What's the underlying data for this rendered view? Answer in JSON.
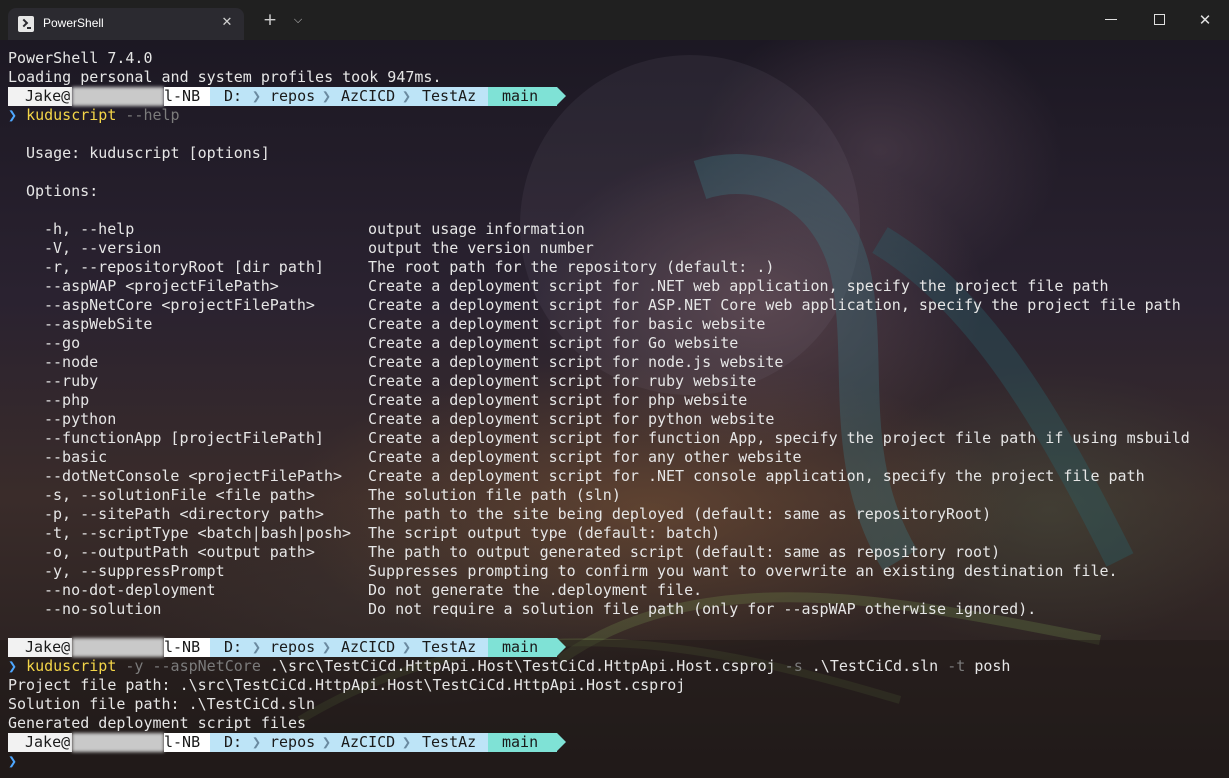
{
  "window": {
    "tab_title": "PowerShell",
    "tab_close": "✕",
    "new_tab": "+",
    "dropdown": "⌵",
    "close": "✕"
  },
  "terminal": {
    "line1": "PowerShell 7.4.0",
    "line2": "Loading personal and system profiles took 947ms.",
    "prompt": {
      "user": "Jake@",
      "host_suffix": "l-NB",
      "drive": "D:",
      "dirs": [
        "repos",
        "AzCICD",
        "TestAz"
      ],
      "branch": "main",
      "branch_icon": "",
      "symbol": "❯"
    },
    "cmd1": {
      "exe": "kuduscript",
      "args": " --help"
    },
    "usage": "Usage: kuduscript [options]",
    "options_header": "Options:",
    "options": [
      {
        "flag": "-h, --help",
        "desc": "output usage information"
      },
      {
        "flag": "-V, --version",
        "desc": "output the version number"
      },
      {
        "flag": "-r, --repositoryRoot [dir path]",
        "desc": "The root path for the repository (default: .)"
      },
      {
        "flag": "--aspWAP <projectFilePath>",
        "desc": "Create a deployment script for .NET web application, specify the project file path"
      },
      {
        "flag": "--aspNetCore <projectFilePath>",
        "desc": "Create a deployment script for ASP.NET Core web application, specify the project file path"
      },
      {
        "flag": "--aspWebSite",
        "desc": "Create a deployment script for basic website"
      },
      {
        "flag": "--go",
        "desc": "Create a deployment script for Go website"
      },
      {
        "flag": "--node",
        "desc": "Create a deployment script for node.js website"
      },
      {
        "flag": "--ruby",
        "desc": "Create a deployment script for ruby website"
      },
      {
        "flag": "--php",
        "desc": "Create a deployment script for php website"
      },
      {
        "flag": "--python",
        "desc": "Create a deployment script for python website"
      },
      {
        "flag": "--functionApp [projectFilePath]",
        "desc": "Create a deployment script for function App, specify the project file path if using msbuild"
      },
      {
        "flag": "--basic",
        "desc": "Create a deployment script for any other website"
      },
      {
        "flag": "--dotNetConsole <projectFilePath>",
        "desc": "Create a deployment script for .NET console application, specify the project file path"
      },
      {
        "flag": "-s, --solutionFile <file path>",
        "desc": "The solution file path (sln)"
      },
      {
        "flag": "-p, --sitePath <directory path>",
        "desc": "The path to the site being deployed (default: same as repositoryRoot)"
      },
      {
        "flag": "-t, --scriptType <batch|bash|posh>",
        "desc": "The script output type (default: batch)"
      },
      {
        "flag": "-o, --outputPath <output path>",
        "desc": "The path to output generated script (default: same as repository root)"
      },
      {
        "flag": "-y, --suppressPrompt",
        "desc": "Suppresses prompting to confirm you want to overwrite an existing destination file."
      },
      {
        "flag": "--no-dot-deployment",
        "desc": "Do not generate the .deployment file."
      },
      {
        "flag": "--no-solution",
        "desc": "Do not require a solution file path (only for --aspWAP otherwise ignored)."
      }
    ],
    "cmd2": {
      "exe": "kuduscript",
      "parts": [
        " -y",
        " --aspNetCore",
        " .\\src\\TestCiCd.HttpApi.Host\\TestCiCd.HttpApi.Host.csproj",
        " -s",
        " .\\TestCiCd.sln",
        " -t",
        " posh"
      ]
    },
    "out1": "Project file path: .\\src\\TestCiCd.HttpApi.Host\\TestCiCd.HttpApi.Host.csproj",
    "out2": "Solution file path: .\\TestCiCd.sln",
    "out3": "Generated deployment script files"
  },
  "colors": {
    "accent_yellow": "#f3d548",
    "prompt_blue": "#4ea7ff",
    "path_segment": "#bde4f7",
    "git_segment": "#7fe2d6"
  }
}
